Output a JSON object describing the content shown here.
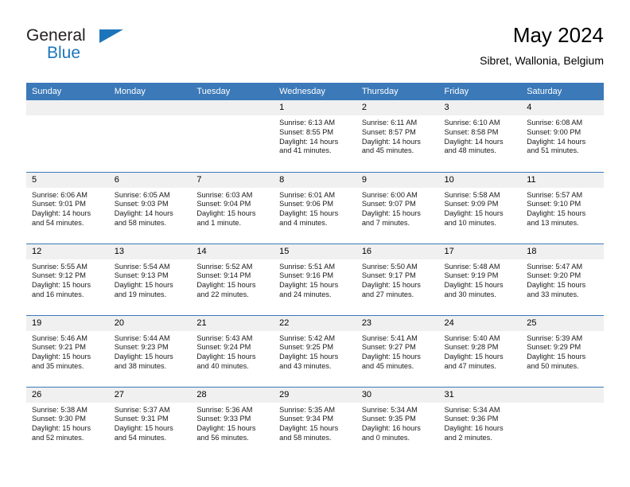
{
  "logo": {
    "primary_text": "General",
    "secondary_text": "Blue",
    "triangle_icon": "triangle-icon",
    "primary_color": "#231f20",
    "secondary_color": "#1b75bb"
  },
  "header": {
    "title": "May 2024",
    "subtitle": "Sibret, Wallonia, Belgium"
  },
  "colors": {
    "header_row": "#3b79b8",
    "day_number_strip": "#f0f0f0",
    "accent": "#1b75bb"
  },
  "weekday_headers": [
    "Sunday",
    "Monday",
    "Tuesday",
    "Wednesday",
    "Thursday",
    "Friday",
    "Saturday"
  ],
  "weeks": [
    [
      {
        "day": "",
        "empty": true,
        "sunrise": "",
        "sunset": "",
        "daylight_line1": "",
        "daylight_line2": ""
      },
      {
        "day": "",
        "empty": true,
        "sunrise": "",
        "sunset": "",
        "daylight_line1": "",
        "daylight_line2": ""
      },
      {
        "day": "",
        "empty": true,
        "sunrise": "",
        "sunset": "",
        "daylight_line1": "",
        "daylight_line2": ""
      },
      {
        "day": "1",
        "empty": false,
        "sunrise": "Sunrise: 6:13 AM",
        "sunset": "Sunset: 8:55 PM",
        "daylight_line1": "Daylight: 14 hours",
        "daylight_line2": "and 41 minutes."
      },
      {
        "day": "2",
        "empty": false,
        "sunrise": "Sunrise: 6:11 AM",
        "sunset": "Sunset: 8:57 PM",
        "daylight_line1": "Daylight: 14 hours",
        "daylight_line2": "and 45 minutes."
      },
      {
        "day": "3",
        "empty": false,
        "sunrise": "Sunrise: 6:10 AM",
        "sunset": "Sunset: 8:58 PM",
        "daylight_line1": "Daylight: 14 hours",
        "daylight_line2": "and 48 minutes."
      },
      {
        "day": "4",
        "empty": false,
        "sunrise": "Sunrise: 6:08 AM",
        "sunset": "Sunset: 9:00 PM",
        "daylight_line1": "Daylight: 14 hours",
        "daylight_line2": "and 51 minutes."
      }
    ],
    [
      {
        "day": "5",
        "empty": false,
        "sunrise": "Sunrise: 6:06 AM",
        "sunset": "Sunset: 9:01 PM",
        "daylight_line1": "Daylight: 14 hours",
        "daylight_line2": "and 54 minutes."
      },
      {
        "day": "6",
        "empty": false,
        "sunrise": "Sunrise: 6:05 AM",
        "sunset": "Sunset: 9:03 PM",
        "daylight_line1": "Daylight: 14 hours",
        "daylight_line2": "and 58 minutes."
      },
      {
        "day": "7",
        "empty": false,
        "sunrise": "Sunrise: 6:03 AM",
        "sunset": "Sunset: 9:04 PM",
        "daylight_line1": "Daylight: 15 hours",
        "daylight_line2": "and 1 minute."
      },
      {
        "day": "8",
        "empty": false,
        "sunrise": "Sunrise: 6:01 AM",
        "sunset": "Sunset: 9:06 PM",
        "daylight_line1": "Daylight: 15 hours",
        "daylight_line2": "and 4 minutes."
      },
      {
        "day": "9",
        "empty": false,
        "sunrise": "Sunrise: 6:00 AM",
        "sunset": "Sunset: 9:07 PM",
        "daylight_line1": "Daylight: 15 hours",
        "daylight_line2": "and 7 minutes."
      },
      {
        "day": "10",
        "empty": false,
        "sunrise": "Sunrise: 5:58 AM",
        "sunset": "Sunset: 9:09 PM",
        "daylight_line1": "Daylight: 15 hours",
        "daylight_line2": "and 10 minutes."
      },
      {
        "day": "11",
        "empty": false,
        "sunrise": "Sunrise: 5:57 AM",
        "sunset": "Sunset: 9:10 PM",
        "daylight_line1": "Daylight: 15 hours",
        "daylight_line2": "and 13 minutes."
      }
    ],
    [
      {
        "day": "12",
        "empty": false,
        "sunrise": "Sunrise: 5:55 AM",
        "sunset": "Sunset: 9:12 PM",
        "daylight_line1": "Daylight: 15 hours",
        "daylight_line2": "and 16 minutes."
      },
      {
        "day": "13",
        "empty": false,
        "sunrise": "Sunrise: 5:54 AM",
        "sunset": "Sunset: 9:13 PM",
        "daylight_line1": "Daylight: 15 hours",
        "daylight_line2": "and 19 minutes."
      },
      {
        "day": "14",
        "empty": false,
        "sunrise": "Sunrise: 5:52 AM",
        "sunset": "Sunset: 9:14 PM",
        "daylight_line1": "Daylight: 15 hours",
        "daylight_line2": "and 22 minutes."
      },
      {
        "day": "15",
        "empty": false,
        "sunrise": "Sunrise: 5:51 AM",
        "sunset": "Sunset: 9:16 PM",
        "daylight_line1": "Daylight: 15 hours",
        "daylight_line2": "and 24 minutes."
      },
      {
        "day": "16",
        "empty": false,
        "sunrise": "Sunrise: 5:50 AM",
        "sunset": "Sunset: 9:17 PM",
        "daylight_line1": "Daylight: 15 hours",
        "daylight_line2": "and 27 minutes."
      },
      {
        "day": "17",
        "empty": false,
        "sunrise": "Sunrise: 5:48 AM",
        "sunset": "Sunset: 9:19 PM",
        "daylight_line1": "Daylight: 15 hours",
        "daylight_line2": "and 30 minutes."
      },
      {
        "day": "18",
        "empty": false,
        "sunrise": "Sunrise: 5:47 AM",
        "sunset": "Sunset: 9:20 PM",
        "daylight_line1": "Daylight: 15 hours",
        "daylight_line2": "and 33 minutes."
      }
    ],
    [
      {
        "day": "19",
        "empty": false,
        "sunrise": "Sunrise: 5:46 AM",
        "sunset": "Sunset: 9:21 PM",
        "daylight_line1": "Daylight: 15 hours",
        "daylight_line2": "and 35 minutes."
      },
      {
        "day": "20",
        "empty": false,
        "sunrise": "Sunrise: 5:44 AM",
        "sunset": "Sunset: 9:23 PM",
        "daylight_line1": "Daylight: 15 hours",
        "daylight_line2": "and 38 minutes."
      },
      {
        "day": "21",
        "empty": false,
        "sunrise": "Sunrise: 5:43 AM",
        "sunset": "Sunset: 9:24 PM",
        "daylight_line1": "Daylight: 15 hours",
        "daylight_line2": "and 40 minutes."
      },
      {
        "day": "22",
        "empty": false,
        "sunrise": "Sunrise: 5:42 AM",
        "sunset": "Sunset: 9:25 PM",
        "daylight_line1": "Daylight: 15 hours",
        "daylight_line2": "and 43 minutes."
      },
      {
        "day": "23",
        "empty": false,
        "sunrise": "Sunrise: 5:41 AM",
        "sunset": "Sunset: 9:27 PM",
        "daylight_line1": "Daylight: 15 hours",
        "daylight_line2": "and 45 minutes."
      },
      {
        "day": "24",
        "empty": false,
        "sunrise": "Sunrise: 5:40 AM",
        "sunset": "Sunset: 9:28 PM",
        "daylight_line1": "Daylight: 15 hours",
        "daylight_line2": "and 47 minutes."
      },
      {
        "day": "25",
        "empty": false,
        "sunrise": "Sunrise: 5:39 AM",
        "sunset": "Sunset: 9:29 PM",
        "daylight_line1": "Daylight: 15 hours",
        "daylight_line2": "and 50 minutes."
      }
    ],
    [
      {
        "day": "26",
        "empty": false,
        "sunrise": "Sunrise: 5:38 AM",
        "sunset": "Sunset: 9:30 PM",
        "daylight_line1": "Daylight: 15 hours",
        "daylight_line2": "and 52 minutes."
      },
      {
        "day": "27",
        "empty": false,
        "sunrise": "Sunrise: 5:37 AM",
        "sunset": "Sunset: 9:31 PM",
        "daylight_line1": "Daylight: 15 hours",
        "daylight_line2": "and 54 minutes."
      },
      {
        "day": "28",
        "empty": false,
        "sunrise": "Sunrise: 5:36 AM",
        "sunset": "Sunset: 9:33 PM",
        "daylight_line1": "Daylight: 15 hours",
        "daylight_line2": "and 56 minutes."
      },
      {
        "day": "29",
        "empty": false,
        "sunrise": "Sunrise: 5:35 AM",
        "sunset": "Sunset: 9:34 PM",
        "daylight_line1": "Daylight: 15 hours",
        "daylight_line2": "and 58 minutes."
      },
      {
        "day": "30",
        "empty": false,
        "sunrise": "Sunrise: 5:34 AM",
        "sunset": "Sunset: 9:35 PM",
        "daylight_line1": "Daylight: 16 hours",
        "daylight_line2": "and 0 minutes."
      },
      {
        "day": "31",
        "empty": false,
        "sunrise": "Sunrise: 5:34 AM",
        "sunset": "Sunset: 9:36 PM",
        "daylight_line1": "Daylight: 16 hours",
        "daylight_line2": "and 2 minutes."
      },
      {
        "day": "",
        "empty": true,
        "sunrise": "",
        "sunset": "",
        "daylight_line1": "",
        "daylight_line2": ""
      }
    ]
  ]
}
